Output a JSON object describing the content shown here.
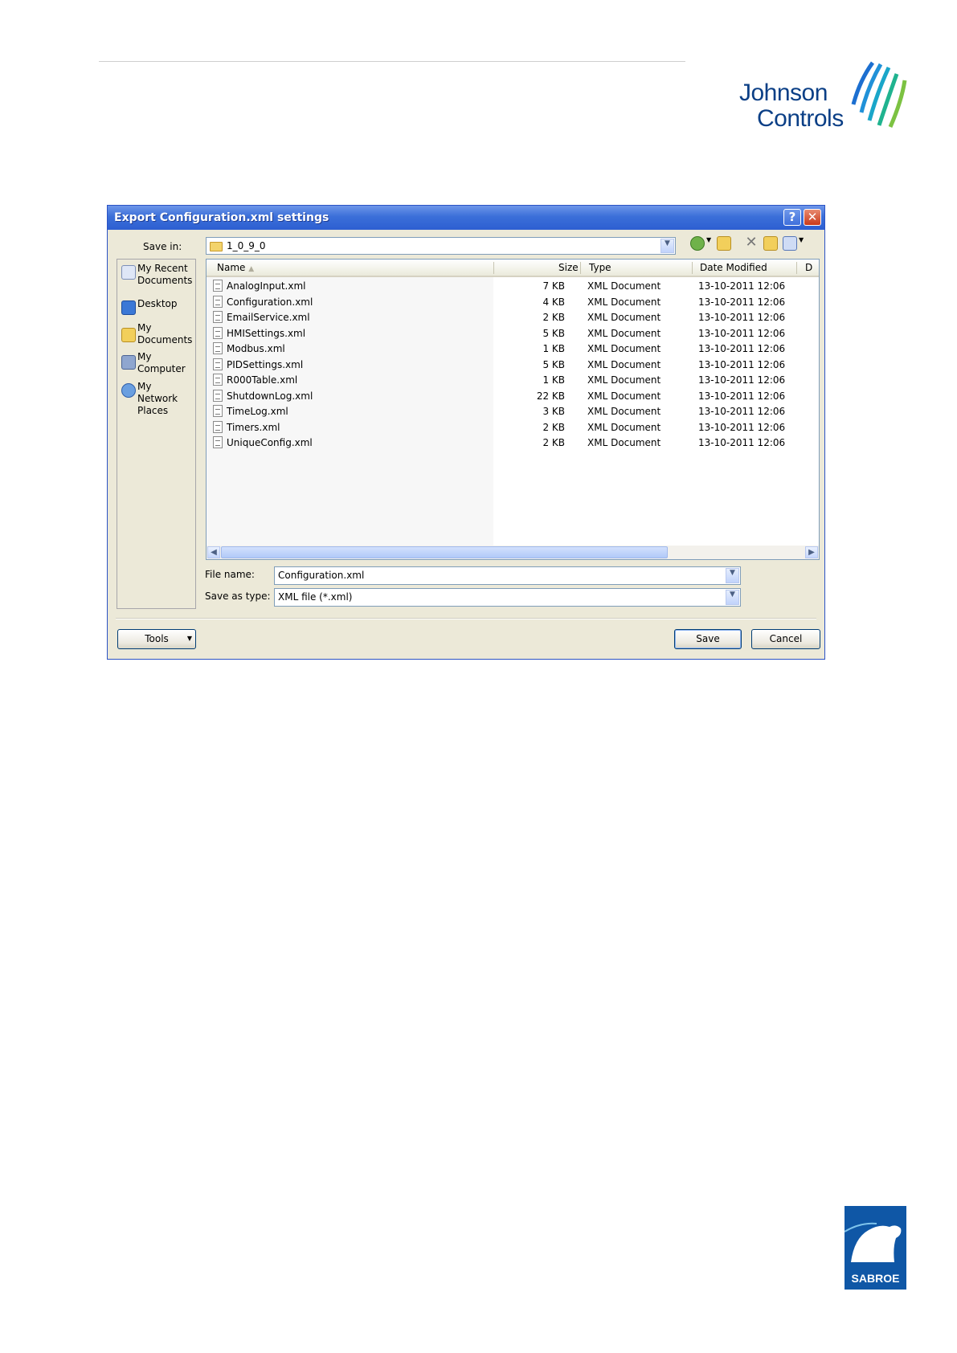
{
  "brand": {
    "jc_line1": "Johnson",
    "jc_line2": "Controls",
    "sabroe": "SABROE"
  },
  "dialog": {
    "title": "Export Configuration.xml settings",
    "help_label": "?",
    "close_label": "✕",
    "save_in_label": "Save in:",
    "save_in_value": "1_0_9_0",
    "file_name_label": "File name:",
    "file_name_value": "Configuration.xml",
    "save_as_type_label": "Save as type:",
    "save_as_type_value": "XML file (*.xml)",
    "tools_label": "Tools",
    "save_label": "Save",
    "cancel_label": "Cancel"
  },
  "places": [
    {
      "label": "My Recent\nDocuments",
      "icon": "recent-documents-icon"
    },
    {
      "label": "Desktop",
      "icon": "desktop-icon"
    },
    {
      "label": "My\nDocuments",
      "icon": "my-documents-icon"
    },
    {
      "label": "My\nComputer",
      "icon": "my-computer-icon"
    },
    {
      "label": "My Network\nPlaces",
      "icon": "network-places-icon"
    }
  ],
  "columns": {
    "name": "Name",
    "size": "Size",
    "type": "Type",
    "date": "Date Modified",
    "extra": "D"
  },
  "files": [
    {
      "name": "AnalogInput.xml",
      "size": "7 KB",
      "type": "XML Document",
      "date": "13-10-2011 12:06"
    },
    {
      "name": "Configuration.xml",
      "size": "4 KB",
      "type": "XML Document",
      "date": "13-10-2011 12:06"
    },
    {
      "name": "EmailService.xml",
      "size": "2 KB",
      "type": "XML Document",
      "date": "13-10-2011 12:06"
    },
    {
      "name": "HMISettings.xml",
      "size": "5 KB",
      "type": "XML Document",
      "date": "13-10-2011 12:06"
    },
    {
      "name": "Modbus.xml",
      "size": "1 KB",
      "type": "XML Document",
      "date": "13-10-2011 12:06"
    },
    {
      "name": "PIDSettings.xml",
      "size": "5 KB",
      "type": "XML Document",
      "date": "13-10-2011 12:06"
    },
    {
      "name": "R000Table.xml",
      "size": "1 KB",
      "type": "XML Document",
      "date": "13-10-2011 12:06"
    },
    {
      "name": "ShutdownLog.xml",
      "size": "22 KB",
      "type": "XML Document",
      "date": "13-10-2011 12:06"
    },
    {
      "name": "TimeLog.xml",
      "size": "3 KB",
      "type": "XML Document",
      "date": "13-10-2011 12:06"
    },
    {
      "name": "Timers.xml",
      "size": "2 KB",
      "type": "XML Document",
      "date": "13-10-2011 12:06"
    },
    {
      "name": "UniqueConfig.xml",
      "size": "2 KB",
      "type": "XML Document",
      "date": "13-10-2011 12:06"
    }
  ]
}
